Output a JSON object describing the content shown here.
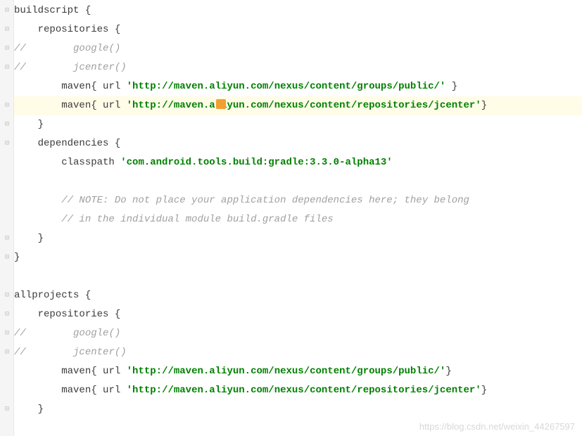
{
  "code": {
    "line1": {
      "text": "buildscript ",
      "brace": "{"
    },
    "line2": {
      "indent": "    ",
      "text": "repositories ",
      "brace": "{"
    },
    "line3": {
      "slash": "//",
      "indent": "        ",
      "text": "google()"
    },
    "line4": {
      "slash": "//",
      "indent": "        ",
      "text": "jcenter()"
    },
    "line5": {
      "indent": "        ",
      "fn": "maven",
      "open": "{ ",
      "key": "url ",
      "str": "'http://maven.aliyun.com/nexus/content/groups/public/'",
      "close": " }"
    },
    "line6": {
      "indent": "        ",
      "fn": "maven",
      "open": "{ ",
      "key": "url ",
      "str_a": "'http://maven.al",
      "str_b": "iyun.com/nexus/content/repositories/jcenter'",
      "close": "}"
    },
    "line7": {
      "indent": "    ",
      "brace": "}"
    },
    "line8": {
      "indent": "    ",
      "text": "dependencies ",
      "brace": "{"
    },
    "line9": {
      "indent": "        ",
      "key": "classpath ",
      "str": "'com.android.tools.build:gradle:3.3.0-alpha13'"
    },
    "line10": "",
    "line11": {
      "indent": "        ",
      "text": "// NOTE: Do not place your application dependencies here; they belong"
    },
    "line12": {
      "indent": "        ",
      "text": "// in the individual module build.gradle files"
    },
    "line13": {
      "indent": "    ",
      "brace": "}"
    },
    "line14": {
      "brace": "}"
    },
    "line15": "",
    "line16": {
      "text": "allprojects ",
      "brace": "{"
    },
    "line17": {
      "indent": "    ",
      "text": "repositories ",
      "brace": "{"
    },
    "line18": {
      "slash": "//",
      "indent": "        ",
      "text": "google()"
    },
    "line19": {
      "slash": "//",
      "indent": "        ",
      "text": "jcenter()"
    },
    "line20": {
      "indent": "        ",
      "fn": "maven",
      "open": "{ ",
      "key": "url ",
      "str": "'http://maven.aliyun.com/nexus/content/groups/public/'",
      "close": "}"
    },
    "line21": {
      "indent": "        ",
      "fn": "maven",
      "open": "{ ",
      "key": "url ",
      "str": "'http://maven.aliyun.com/nexus/content/repositories/jcenter'",
      "close": "}"
    },
    "line22": {
      "indent": "    ",
      "brace": "}"
    }
  },
  "gutter_marks": {
    "fold_open": "⊟",
    "fold_close": "⊟",
    "dash": "⊟"
  },
  "watermark": "https://blog.csdn.net/weixin_44267597"
}
